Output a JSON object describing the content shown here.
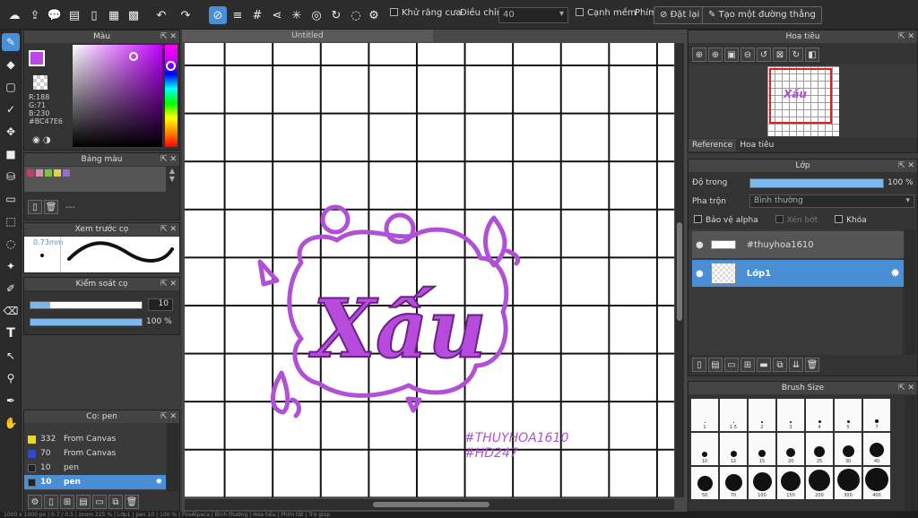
{
  "toolbar": {
    "antialias_label": "Khử răng cưa",
    "adjust_label": "Điều chỉnh",
    "adjust_value": "40",
    "soft_edge_label": "Cạnh mềm",
    "key_label": "Phím",
    "reset_label": "Đặt lại",
    "straight_line_label": "Tạo một đường thẳng"
  },
  "color_panel": {
    "title": "Màu",
    "r": "R:188",
    "g": "G:71",
    "b": "B:230",
    "hex": "#BC47E6",
    "primary_color": "#bc47e6"
  },
  "palette_panel": {
    "title": "Bảng màu",
    "dash": "---",
    "swatches": [
      "#c0415f",
      "#d98cb0",
      "#7bc24a",
      "#e0d44a",
      "#9a6ad8"
    ]
  },
  "preview_panel": {
    "title": "Xem trước cọ",
    "size": "0.73mm"
  },
  "brush_control": {
    "title": "Kiểm soát cọ",
    "size_value": "10",
    "opacity_value": "100",
    "opacity_unit": "%"
  },
  "brush_list": {
    "title": "Cọ: pen",
    "items": [
      {
        "size": "332",
        "name": "From Canvas",
        "color": "#e8d81e"
      },
      {
        "size": "70",
        "name": "From Canvas",
        "color": "#2e4bd6"
      },
      {
        "size": "10",
        "name": "pen",
        "color": "#222"
      },
      {
        "size": "10",
        "name": "pen",
        "color": "#222"
      }
    ]
  },
  "canvas": {
    "doc_title": "Untitled",
    "art_word": "Xấu",
    "tag1": "#THUYHOA1610",
    "tag2": "#HD247"
  },
  "navigator": {
    "title": "Hoa tiêu",
    "tab_reference": "Reference",
    "tab_navigator": "Hoa tiêu"
  },
  "layer_panel": {
    "title": "Lớp",
    "opacity_label": "Độ trong",
    "opacity_value": "100 %",
    "blend_label": "Pha trộn",
    "blend_value": "Bình thường",
    "protect_alpha": "Bảo vệ alpha",
    "clipping": "Xén bớt",
    "lock": "Khóa",
    "layers": [
      {
        "name": "#thuyhoa1610"
      },
      {
        "name": "Lớp1"
      }
    ]
  },
  "brush_size": {
    "title": "Brush Size",
    "sizes": [
      "1",
      "1.5",
      "2",
      "3",
      "4",
      "5",
      "7",
      "10",
      "12",
      "15",
      "20",
      "25",
      "30",
      "40",
      "50",
      "70",
      "100",
      "150",
      "200",
      "300",
      "400"
    ]
  },
  "statusbar": {
    "text": "1000 x 1000 px  |  0.7 / 0.5  |  zoom 225 %  |  Lớp1  |  pen 10  |  100 %  |  FireAlpaca  |  Bình thường  |  Hoa tiêu  |  Phím tắt  |  Trợ giúp"
  }
}
